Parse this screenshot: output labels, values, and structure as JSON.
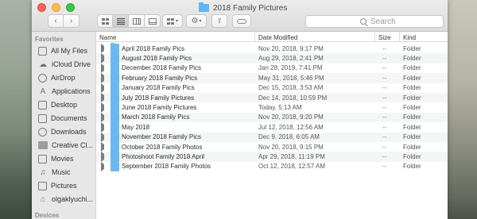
{
  "window": {
    "title": "2018 Family Pictures"
  },
  "toolbar": {
    "back_glyph": "‹",
    "forward_glyph": "›",
    "search_placeholder": "Search"
  },
  "sidebar": {
    "favorites_heading": "Favorites",
    "devices_heading": "Devices",
    "items": [
      {
        "label": "All My Files",
        "icon": "all-files-icon"
      },
      {
        "label": "iCloud Drive",
        "icon": "cloud-icon"
      },
      {
        "label": "AirDrop",
        "icon": "airdrop-icon"
      },
      {
        "label": "Applications",
        "icon": "applications-icon"
      },
      {
        "label": "Desktop",
        "icon": "desktop-icon"
      },
      {
        "label": "Documents",
        "icon": "documents-icon"
      },
      {
        "label": "Downloads",
        "icon": "downloads-icon"
      },
      {
        "label": "Creative Cl...",
        "icon": "folder-icon"
      },
      {
        "label": "Movies",
        "icon": "movies-icon"
      },
      {
        "label": "Music",
        "icon": "music-icon"
      },
      {
        "label": "Pictures",
        "icon": "pictures-icon"
      },
      {
        "label": "olgaklyuchi...",
        "icon": "home-icon"
      }
    ]
  },
  "columns": {
    "name": "Name",
    "date": "Date Modified",
    "size": "Size",
    "kind": "Kind"
  },
  "rows": [
    {
      "name": "April 2018 Family Pics",
      "date": "Nov 20, 2018, 9:17 PM",
      "size": "--",
      "kind": "Folder"
    },
    {
      "name": "August 2018 Family Pics",
      "date": "Aug 29, 2018, 2:41 PM",
      "size": "--",
      "kind": "Folder"
    },
    {
      "name": "December 2018 Family Pics",
      "date": "Jan 28, 2019, 7:41 PM",
      "size": "--",
      "kind": "Folder"
    },
    {
      "name": "February 2018 Family Pics",
      "date": "May 31, 2018, 5:46 PM",
      "size": "--",
      "kind": "Folder"
    },
    {
      "name": "January 2018 Family Pics",
      "date": "Dec 15, 2018, 3:53 AM",
      "size": "--",
      "kind": "Folder"
    },
    {
      "name": "July 2018 Family Pictures",
      "date": "Dec 14, 2018, 10:59 PM",
      "size": "--",
      "kind": "Folder"
    },
    {
      "name": "June 2018 Family Pictures",
      "date": "Today, 5:13 AM",
      "size": "--",
      "kind": "Folder"
    },
    {
      "name": "March 2018 Family Pics",
      "date": "Nov 20, 2018, 9:20 PM",
      "size": "--",
      "kind": "Folder"
    },
    {
      "name": "May 2018",
      "date": "Jul 12, 2018, 12:56 AM",
      "size": "--",
      "kind": "Folder"
    },
    {
      "name": "November 2018 Family Pics",
      "date": "Dec 9, 2018, 6:05 AM",
      "size": "--",
      "kind": "Folder"
    },
    {
      "name": "October 2018 Family Photos",
      "date": "Nov 20, 2018, 9:15 PM",
      "size": "--",
      "kind": "Folder"
    },
    {
      "name": "Photoshoot Family 2018 April",
      "date": "Apr 29, 2018, 11:19 PM",
      "size": "--",
      "kind": "Folder"
    },
    {
      "name": "September 2018 Family Photos",
      "date": "Oct 12, 2018, 12:57 AM",
      "size": "--",
      "kind": "Folder"
    }
  ]
}
